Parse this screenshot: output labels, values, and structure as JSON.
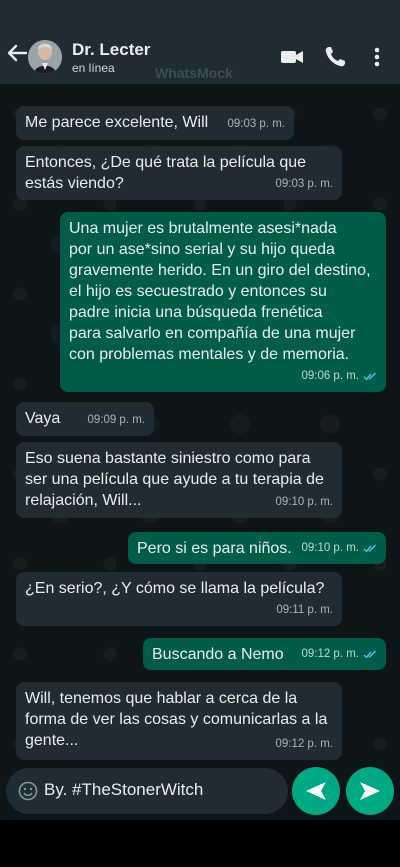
{
  "header": {
    "contact_name": "Dr. Lecter",
    "status": "en línea",
    "watermark": "WhatsMock"
  },
  "messages": [
    {
      "direction": "incoming",
      "text": "Me parece excelente, Will",
      "time": "09:03 p. m."
    },
    {
      "direction": "incoming",
      "text": "Entonces, ¿De qué trata la película que\nestás viendo?",
      "time": "09:03 p. m."
    },
    {
      "direction": "outgoing",
      "text": "Una mujer es brutalmente asesi*nada\npor un ase*sino serial y su hijo queda\ngravemente herido. En un giro del destino,\nel hijo es secuestrado y entonces su\npadre inicia una búsqueda frenética\npara salvarlo en compañía de una mujer\ncon problemas mentales y de memoria.",
      "time": "09:06 p. m.",
      "read": true
    },
    {
      "direction": "incoming",
      "text": "Vaya",
      "time": "09:09 p. m."
    },
    {
      "direction": "incoming",
      "text": "Eso suena bastante siniestro como para\nser una película que ayude a tu terapia de\nrelajación, Will...",
      "time": "09:10 p. m."
    },
    {
      "direction": "outgoing",
      "text": "Pero si es para niños.",
      "time": "09:10 p. m.",
      "read": true
    },
    {
      "direction": "incoming",
      "text": "¿En serio?, ¿Y cómo se llama la película?",
      "time": "09:11 p. m."
    },
    {
      "direction": "outgoing",
      "text": "Buscando a Nemo",
      "time": "09:12 p. m.",
      "read": true
    },
    {
      "direction": "incoming",
      "text": "Will, tenemos que hablar a cerca de la\nforma de ver las cosas y comunicarlas a la\ngente...",
      "time": "09:12 p. m."
    }
  ],
  "composer": {
    "input_text": "By. #TheStonerWitch"
  },
  "colors": {
    "incoming_bubble": "#202c33",
    "outgoing_bubble": "#005c4b",
    "accent": "#00a884",
    "read_ticks": "#53bdeb"
  }
}
